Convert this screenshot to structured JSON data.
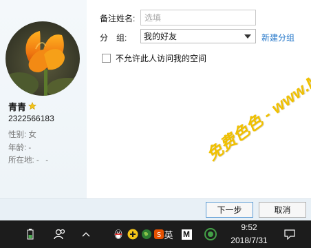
{
  "contact": {
    "nickname": "青青",
    "qq_number": "2322566183",
    "gender": "性别: 女",
    "age": "年龄: -",
    "location": "所在地: -   -"
  },
  "form": {
    "remark_label": "备注姓名:",
    "remark_placeholder": "选填",
    "remark_value": "",
    "group_label": "分　组:",
    "group_value": "我的好友",
    "new_group_link": "新建分组",
    "privacy_checkbox_label": "不允许此人访问我的空间",
    "privacy_checked": false
  },
  "buttons": {
    "next": "下一步",
    "cancel": "取消"
  },
  "taskbar": {
    "ime_lang": "英",
    "ime_mode": "M",
    "time": "9:52",
    "date": "2018/7/31"
  },
  "watermark": "免费色色 - www.MFsese.com",
  "colors": {
    "link": "#1e73c8",
    "taskbar": "#1c1c1c",
    "watermark": "#f0c000"
  }
}
